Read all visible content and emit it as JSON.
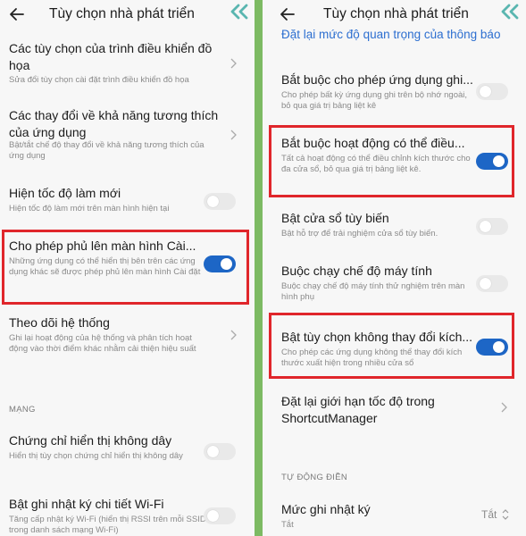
{
  "colors": {
    "page_bg": "#7dba63",
    "panel_bg": "#f7f7f7",
    "accent_blue": "#1d66c6",
    "highlight_red": "#e0262b"
  },
  "left": {
    "header": {
      "title": "Tùy chọn nhà phát triển"
    },
    "items": [
      {
        "title": "Các tùy chọn của trình điều khiển đồ họa",
        "subtitle": "Sửa đổi tùy chọn cài đặt trình điều khiển đồ họa",
        "control": "chevron"
      },
      {
        "title": "Các thay đổi về khả năng tương thích của ứng dụng",
        "subtitle": "Bật/tắt chế độ thay đổi về khả năng tương thích của ứng dụng",
        "control": "chevron"
      },
      {
        "title": "Hiện tốc độ làm mới",
        "subtitle": "Hiện tốc độ làm mới trên màn hình hiện tại",
        "control": "switch",
        "on": false
      },
      {
        "title": "Cho phép phủ lên màn hình Cài...",
        "subtitle": "Những ứng dụng có thể hiển thị bên trên các ứng dụng khác sẽ được phép phủ lên màn hình Cài đặt",
        "control": "switch",
        "on": true,
        "highlighted": true
      },
      {
        "title": "Theo dõi hệ thống",
        "subtitle": "Ghi lại hoạt động của hệ thống và phân tích hoạt động vào thời điểm khác nhằm cải thiện hiệu suất",
        "control": "chevron"
      }
    ],
    "section_header": "MẠNG",
    "network_items": [
      {
        "title": "Chứng chỉ hiển thị không dây",
        "subtitle": "Hiển thị tùy chọn chứng chỉ hiển thị không dây",
        "control": "switch",
        "on": false
      },
      {
        "title": "Bật ghi nhật ký chi tiết Wi-Fi",
        "subtitle": "Tăng cấp nhật ký Wi-Fi (hiển thị RSSI trên mỗi SSID trong danh sách mạng Wi-Fi)",
        "control": "switch",
        "on": false
      }
    ]
  },
  "right": {
    "header": {
      "title": "Tùy chọn nhà phát triển"
    },
    "partial_top_text": "Đặt lại mức độ quan trọng của thông báo",
    "items": [
      {
        "title": "Bắt buộc cho phép ứng dụng ghi...",
        "subtitle": "Cho phép bất kỳ ứng dụng ghi trên bộ nhớ ngoài, bỏ qua giá trị bảng liệt kê",
        "control": "switch",
        "on": false
      },
      {
        "title": "Bắt buộc hoạt động có thể điều...",
        "subtitle": "Tất cả hoạt động có thể điều chỉnh kích thước cho đa cửa sổ, bỏ qua giá trị bảng liệt kê.",
        "control": "switch",
        "on": true,
        "highlighted": true
      },
      {
        "title": "Bật cửa sổ tùy biến",
        "subtitle": "Bật hỗ trợ để trải nghiệm cửa sổ tùy biến.",
        "control": "switch",
        "on": false
      },
      {
        "title": "Buộc chạy chế độ máy tính",
        "subtitle": "Buộc chạy chế độ máy tính thử nghiệm trên màn hình phụ",
        "control": "switch",
        "on": false
      },
      {
        "title": "Bật tùy chọn không thay đổi kích...",
        "subtitle": "Cho phép các ứng dụng không thể thay đổi kích thước xuất hiện trong nhiều cửa sổ",
        "control": "switch",
        "on": true,
        "highlighted": true
      },
      {
        "title": "Đặt lại giới hạn tốc độ trong ShortcutManager",
        "subtitle": "",
        "control": "chevron"
      }
    ],
    "section_header": "TỰ ĐỘNG ĐIỀN",
    "autofill_item": {
      "title": "Mức ghi nhật ký",
      "subtitle": "Tắt",
      "value": "Tắt"
    }
  }
}
